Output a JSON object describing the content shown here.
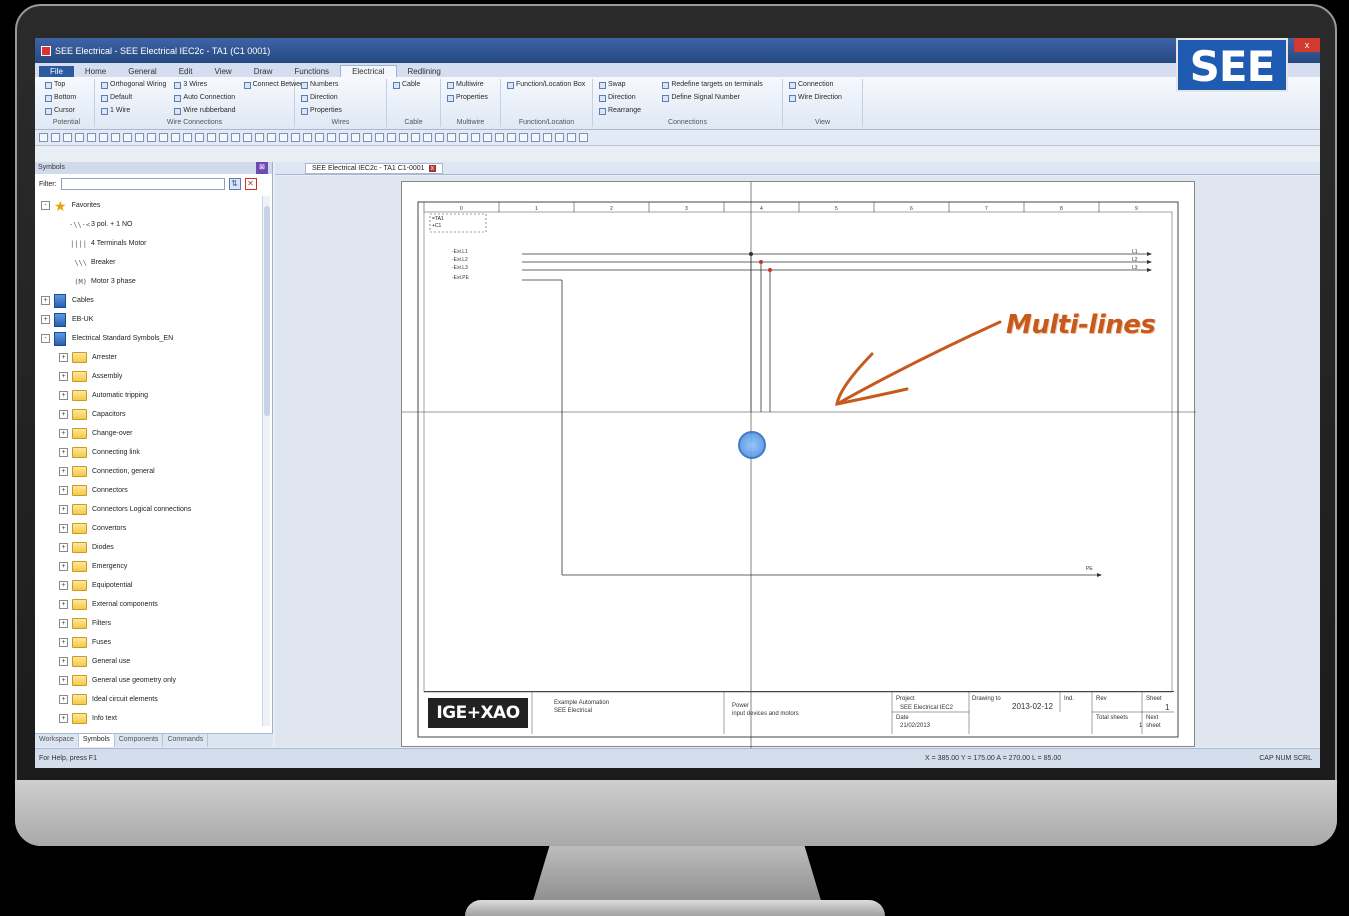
{
  "window": {
    "title": "SEE Electrical - SEE Electrical IEC2c - TA1 (C1 0001)",
    "close_label": "x"
  },
  "brand": {
    "logo_text": "SEE"
  },
  "ribbon": {
    "tabs": [
      "File",
      "Home",
      "General",
      "Edit",
      "View",
      "Draw",
      "Functions",
      "Electrical",
      "Redlining"
    ],
    "groups": [
      {
        "label": "Potential",
        "items": [
          "Top",
          "Bottom",
          "Cursor"
        ]
      },
      {
        "label": "Wire Connections",
        "items": [
          "Orthogonal Wiring",
          "Default",
          "1 Wire",
          "3 Wires",
          "Auto Connection",
          "Wire rubberband",
          "Connect Between"
        ]
      },
      {
        "label": "Wires",
        "items": [
          "Numbers",
          "Direction",
          "Properties"
        ]
      },
      {
        "label": "Cable",
        "items": [
          "Cable"
        ]
      },
      {
        "label": "Multiwire",
        "items": [
          "Multiwire",
          "Properties"
        ]
      },
      {
        "label": "Function/Location",
        "items": [
          "Function/Location Box"
        ]
      },
      {
        "label": "Connections",
        "items": [
          "Swap",
          "Direction",
          "Rearrange",
          "Redefine targets on terminals",
          "Define Signal Number"
        ]
      },
      {
        "label": "View",
        "items": [
          "Connection",
          "Wire Direction"
        ]
      }
    ]
  },
  "left_panel": {
    "title": "Symbols",
    "filter_label": "Filter:",
    "tree": [
      {
        "label": "Favorites",
        "kind": "star",
        "level": 0,
        "expander": "-"
      },
      {
        "label": "3 pol. + 1 NO",
        "kind": "symbol",
        "level": 1,
        "glyph": "-\\\\-<"
      },
      {
        "label": "4 Terminals Motor",
        "kind": "symbol",
        "level": 1,
        "glyph": "||||"
      },
      {
        "label": "Breaker",
        "kind": "symbol",
        "level": 1,
        "glyph": "\\\\\\"
      },
      {
        "label": "Motor 3 phase",
        "kind": "symbol",
        "level": 1,
        "glyph": "(M)"
      },
      {
        "label": "Cables",
        "kind": "book",
        "level": 0,
        "expander": "+"
      },
      {
        "label": "EB-UK",
        "kind": "book",
        "level": 0,
        "expander": "+"
      },
      {
        "label": "Electrical Standard Symbols_EN",
        "kind": "book",
        "level": 0,
        "expander": "-"
      },
      {
        "label": "Arrester",
        "kind": "folder",
        "level": 1,
        "expander": "+"
      },
      {
        "label": "Assembly",
        "kind": "folder",
        "level": 1,
        "expander": "+"
      },
      {
        "label": "Automatic tripping",
        "kind": "folder",
        "level": 1,
        "expander": "+"
      },
      {
        "label": "Capacitors",
        "kind": "folder",
        "level": 1,
        "expander": "+"
      },
      {
        "label": "Change-over",
        "kind": "folder",
        "level": 1,
        "expander": "+"
      },
      {
        "label": "Connecting link",
        "kind": "folder",
        "level": 1,
        "expander": "+"
      },
      {
        "label": "Connection, general",
        "kind": "folder",
        "level": 1,
        "expander": "+"
      },
      {
        "label": "Connectors",
        "kind": "folder",
        "level": 1,
        "expander": "+"
      },
      {
        "label": "Connectors Logical connections",
        "kind": "folder",
        "level": 1,
        "expander": "+"
      },
      {
        "label": "Convertors",
        "kind": "folder",
        "level": 1,
        "expander": "+"
      },
      {
        "label": "Diodes",
        "kind": "folder",
        "level": 1,
        "expander": "+"
      },
      {
        "label": "Emergency",
        "kind": "folder",
        "level": 1,
        "expander": "+"
      },
      {
        "label": "Equipotential",
        "kind": "folder",
        "level": 1,
        "expander": "+"
      },
      {
        "label": "External components",
        "kind": "folder",
        "level": 1,
        "expander": "+"
      },
      {
        "label": "Filters",
        "kind": "folder",
        "level": 1,
        "expander": "+"
      },
      {
        "label": "Fuses",
        "kind": "folder",
        "level": 1,
        "expander": "+"
      },
      {
        "label": "General use",
        "kind": "folder",
        "level": 1,
        "expander": "+"
      },
      {
        "label": "General use geometry only",
        "kind": "folder",
        "level": 1,
        "expander": "+"
      },
      {
        "label": "Ideal circuit elements",
        "kind": "folder",
        "level": 1,
        "expander": "+"
      },
      {
        "label": "Info text",
        "kind": "folder",
        "level": 1,
        "expander": "+"
      }
    ],
    "bottom_tabs": [
      "Workspace",
      "Symbols",
      "Components",
      "Commands"
    ],
    "active_bottom_tab": "Symbols"
  },
  "document": {
    "tab_label": "SEE Electrical IEC2c - TA1 C1-0001",
    "overlay_caption": "Multi-lines",
    "wire_labels": [
      "-Ext.L1",
      "-Ext.L2",
      "-Ext.L3",
      "-Ext.PE"
    ],
    "wire_targets": [
      "L1",
      "L2",
      "L3"
    ],
    "pe_target": "PE",
    "title_block": {
      "company_logo": "IGE+XAO",
      "description": "Example Automation",
      "subdescription": "SEE Electrical",
      "function_title": "Power",
      "function_sub": "input devices and motors",
      "project_label": "Project",
      "project_value": "SEE Electrical IEC2",
      "date_label": "Date",
      "date_value": "21/02/2013",
      "drawing_label": "Drawing to",
      "drawing_value": "2013-02-12",
      "ind_label": "Ind.",
      "rev_label": "Rev",
      "sheet_label": "Sheet",
      "sheet_value": "1",
      "total_label": "Total sheets",
      "total_value": "1",
      "next_label": "Next sheet",
      "place_code": "=TA1",
      "location_code": "+C1"
    },
    "column_numbers": [
      "0",
      "1",
      "2",
      "3",
      "4",
      "5",
      "6",
      "7",
      "8",
      "9"
    ]
  },
  "status": {
    "help": "For Help, press F1",
    "coords": "X = 385.00  Y = 175.00   A = 270.00 L = 85.00",
    "indicators": "CAP  NUM  SCRL"
  }
}
